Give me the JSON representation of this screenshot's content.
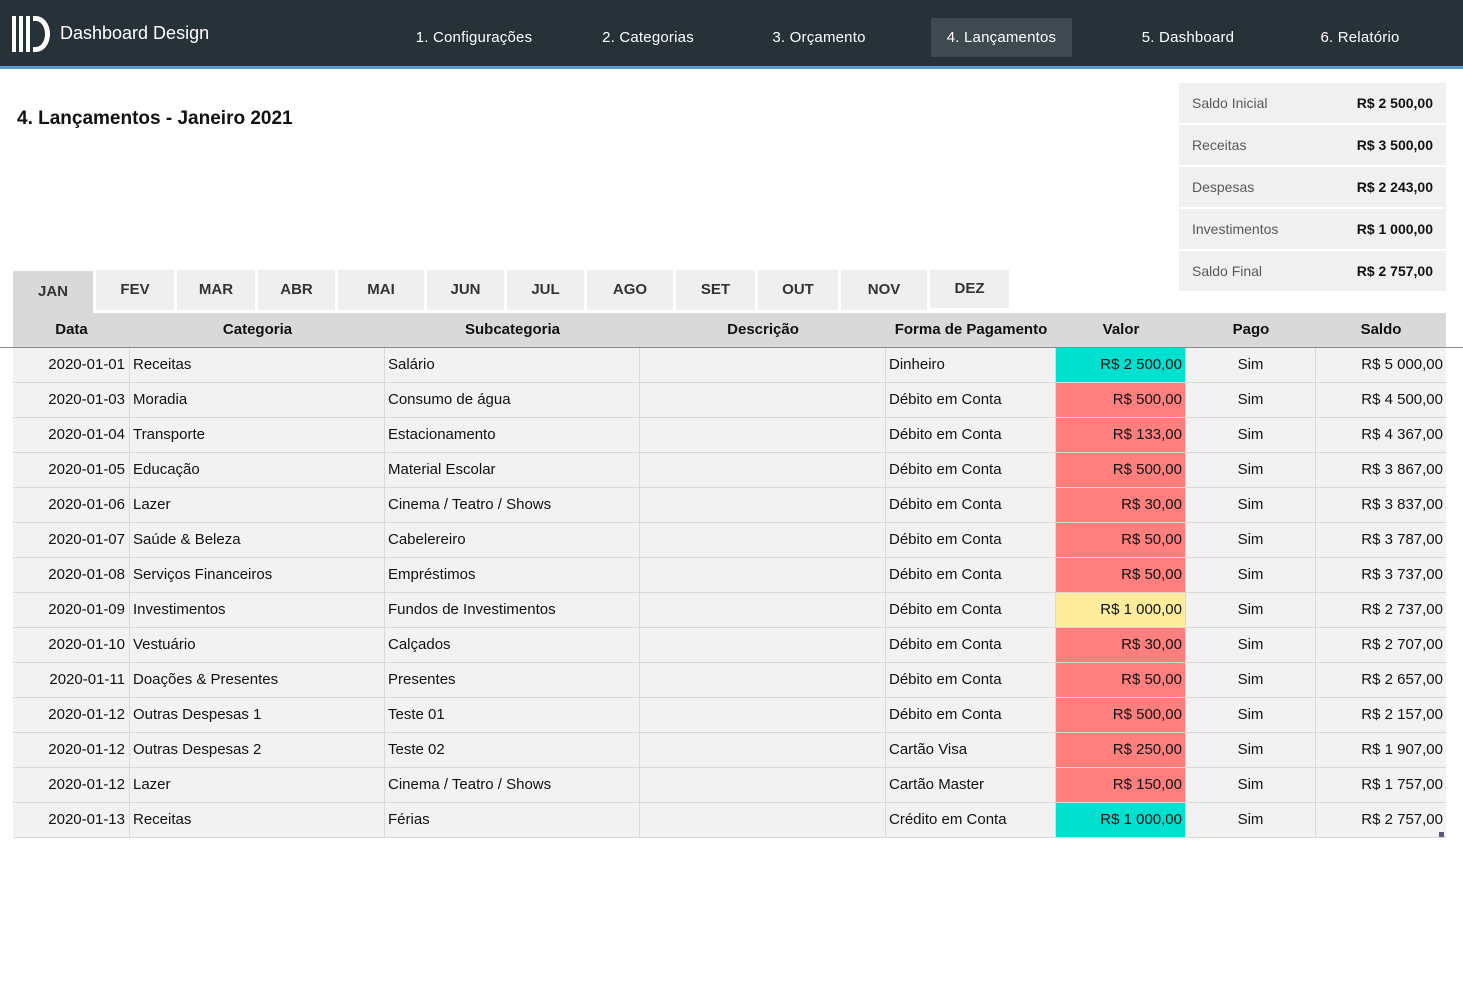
{
  "brand": {
    "name": "Dashboard Design"
  },
  "nav": [
    {
      "label": "1. Configurações",
      "active": false
    },
    {
      "label": "2. Categorias",
      "active": false
    },
    {
      "label": "3.  Orçamento",
      "active": false
    },
    {
      "label": "4.  Lançamentos",
      "active": true
    },
    {
      "label": "5.  Dashboard",
      "active": false
    },
    {
      "label": "6.  Relatório",
      "active": false
    }
  ],
  "page": {
    "title": "4. Lançamentos - Janeiro 2021"
  },
  "summary": [
    {
      "label": "Saldo Inicial",
      "value": "R$ 2 500,00"
    },
    {
      "label": "Receitas",
      "value": "R$ 3 500,00"
    },
    {
      "label": "Despesas",
      "value": "R$ 2 243,00"
    },
    {
      "label": "Investimentos",
      "value": "R$ 1 000,00"
    },
    {
      "label": "Saldo Final",
      "value": "R$ 2 757,00"
    }
  ],
  "months": [
    "JAN",
    "FEV",
    "MAR",
    "ABR",
    "MAI",
    "JUN",
    "JUL",
    "AGO",
    "SET",
    "OUT",
    "NOV",
    "DEZ"
  ],
  "active_month": "JAN",
  "colors": {
    "income": "#00e0d0",
    "expense": "#ff7f7f",
    "investment": "#fcec9c",
    "nav_bg": "#263238",
    "nav_accent": "#5b9bd5"
  },
  "table": {
    "columns": [
      "Data",
      "Categoria",
      "Subcategoria",
      "Descrição",
      "Forma de Pagamento",
      "Valor",
      "Pago",
      "Saldo"
    ],
    "rows": [
      {
        "date": "2020-01-01",
        "category": "Receitas",
        "subcategory": "Salário",
        "description": "",
        "payment": "Dinheiro",
        "value": "R$ 2 500,00",
        "kind": "income",
        "paid": "Sim",
        "balance": "R$ 5 000,00"
      },
      {
        "date": "2020-01-03",
        "category": "Moradia",
        "subcategory": "Consumo de água",
        "description": "",
        "payment": "Débito em Conta",
        "value": "R$ 500,00",
        "kind": "expense",
        "paid": "Sim",
        "balance": "R$ 4 500,00"
      },
      {
        "date": "2020-01-04",
        "category": "Transporte",
        "subcategory": "Estacionamento",
        "description": "",
        "payment": "Débito em Conta",
        "value": "R$ 133,00",
        "kind": "expense",
        "paid": "Sim",
        "balance": "R$ 4 367,00"
      },
      {
        "date": "2020-01-05",
        "category": "Educação",
        "subcategory": "Material Escolar",
        "description": "",
        "payment": "Débito em Conta",
        "value": "R$ 500,00",
        "kind": "expense",
        "paid": "Sim",
        "balance": "R$ 3 867,00"
      },
      {
        "date": "2020-01-06",
        "category": "Lazer",
        "subcategory": "Cinema / Teatro / Shows",
        "description": "",
        "payment": "Débito em Conta",
        "value": "R$ 30,00",
        "kind": "expense",
        "paid": "Sim",
        "balance": "R$ 3 837,00"
      },
      {
        "date": "2020-01-07",
        "category": "Saúde & Beleza",
        "subcategory": "Cabelereiro",
        "description": "",
        "payment": "Débito em Conta",
        "value": "R$ 50,00",
        "kind": "expense",
        "paid": "Sim",
        "balance": "R$ 3 787,00"
      },
      {
        "date": "2020-01-08",
        "category": "Serviços Financeiros",
        "subcategory": "Empréstimos",
        "description": "",
        "payment": "Débito em Conta",
        "value": "R$ 50,00",
        "kind": "expense",
        "paid": "Sim",
        "balance": "R$ 3 737,00"
      },
      {
        "date": "2020-01-09",
        "category": "Investimentos",
        "subcategory": "Fundos de Investimentos",
        "description": "",
        "payment": "Débito em Conta",
        "value": "R$ 1 000,00",
        "kind": "investment",
        "paid": "Sim",
        "balance": "R$ 2 737,00"
      },
      {
        "date": "2020-01-10",
        "category": "Vestuário",
        "subcategory": "Calçados",
        "description": "",
        "payment": "Débito em Conta",
        "value": "R$ 30,00",
        "kind": "expense",
        "paid": "Sim",
        "balance": "R$ 2 707,00"
      },
      {
        "date": "2020-01-11",
        "category": "Doações & Presentes",
        "subcategory": "Presentes",
        "description": "",
        "payment": "Débito em Conta",
        "value": "R$ 50,00",
        "kind": "expense",
        "paid": "Sim",
        "balance": "R$ 2 657,00"
      },
      {
        "date": "2020-01-12",
        "category": "Outras Despesas 1",
        "subcategory": "Teste 01",
        "description": "",
        "payment": "Débito em Conta",
        "value": "R$ 500,00",
        "kind": "expense",
        "paid": "Sim",
        "balance": "R$ 2 157,00"
      },
      {
        "date": "2020-01-12",
        "category": "Outras Despesas 2",
        "subcategory": "Teste 02",
        "description": "",
        "payment": "Cartão Visa",
        "value": "R$ 250,00",
        "kind": "expense",
        "paid": "Sim",
        "balance": "R$ 1 907,00"
      },
      {
        "date": "2020-01-12",
        "category": "Lazer",
        "subcategory": "Cinema / Teatro / Shows",
        "description": "",
        "payment": "Cartão Master",
        "value": "R$ 150,00",
        "kind": "expense",
        "paid": "Sim",
        "balance": "R$ 1 757,00"
      },
      {
        "date": "2020-01-13",
        "category": "Receitas",
        "subcategory": "Férias",
        "description": "",
        "payment": "Crédito em Conta",
        "value": "R$ 1 000,00",
        "kind": "income",
        "paid": "Sim",
        "balance": "R$ 2 757,00"
      }
    ]
  }
}
